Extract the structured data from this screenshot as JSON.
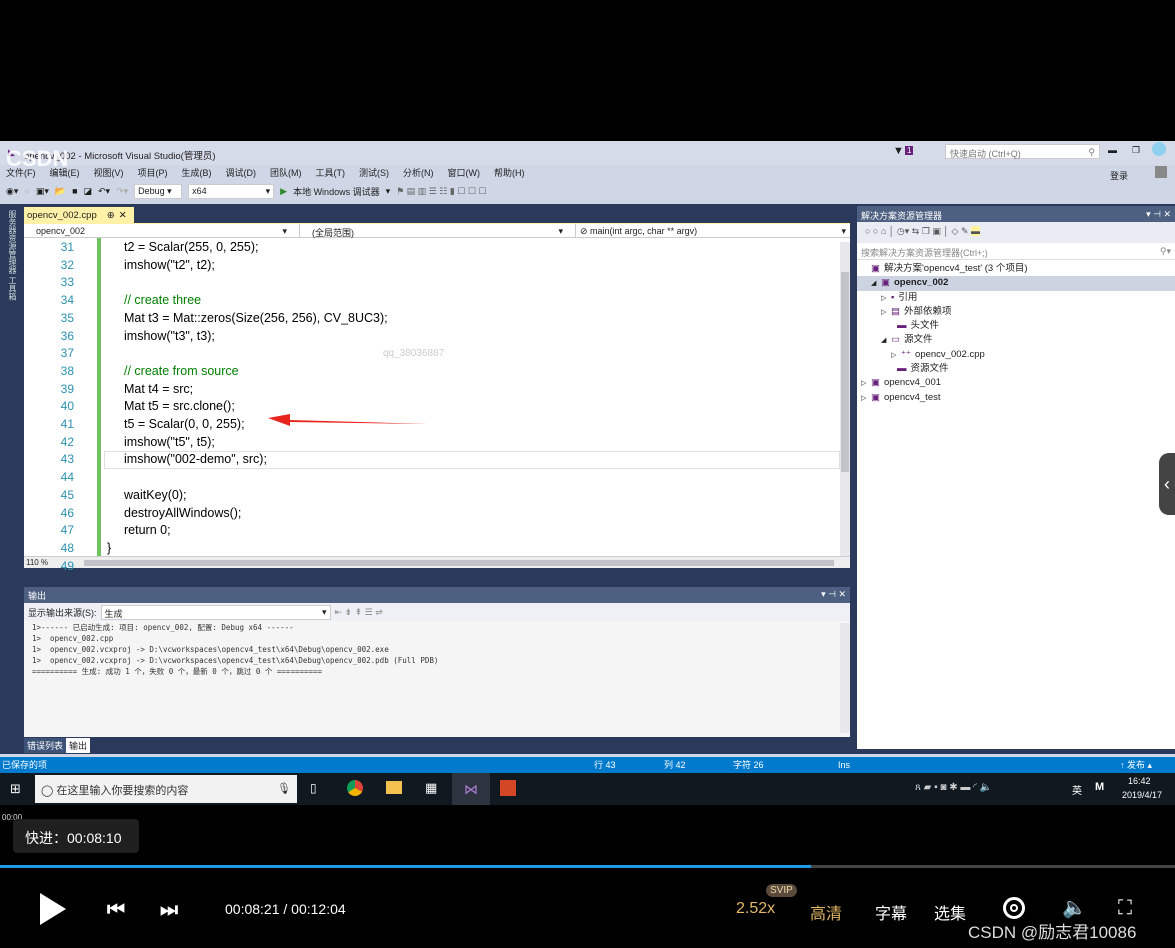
{
  "window": {
    "title": "opencv_002 - Microsoft Visual Studio(管理员)",
    "quick_launch_placeholder": "快速启动 (Ctrl+Q)",
    "notification_count": "1",
    "login": "登录"
  },
  "menu": [
    "文件(F)",
    "编辑(E)",
    "视图(V)",
    "项目(P)",
    "生成(B)",
    "调试(D)",
    "团队(M)",
    "工具(T)",
    "测试(S)",
    "分析(N)",
    "窗口(W)",
    "帮助(H)"
  ],
  "toolbar": {
    "config": "Debug",
    "platform": "x64",
    "run_label": "本地 Windows 调试器"
  },
  "editor": {
    "tab": "opencv_002.cpp",
    "project_dropdown": "opencv_002",
    "scope_dropdown": "(全局范围)",
    "member_dropdown": "main(int argc, char ** argv)",
    "zoom": "110 %",
    "watermark": "qq_38036887",
    "lines": [
      {
        "n": "31",
        "text": "t2 = Scalar(255, 0, 255);"
      },
      {
        "n": "32",
        "text": "imshow(\"t2\", t2);"
      },
      {
        "n": "33",
        "text": ""
      },
      {
        "n": "34",
        "text": "// create three"
      },
      {
        "n": "35",
        "text": "Mat t3 = Mat::zeros(Size(256, 256), CV_8UC3);"
      },
      {
        "n": "36",
        "text": "imshow(\"t3\", t3);"
      },
      {
        "n": "37",
        "text": ""
      },
      {
        "n": "38",
        "text": "// create from source"
      },
      {
        "n": "39",
        "text": "Mat t4 = src;"
      },
      {
        "n": "40",
        "text": "Mat t5 = src.clone();"
      },
      {
        "n": "41",
        "text": "t5 = Scalar(0, 0, 255);"
      },
      {
        "n": "42",
        "text": "imshow(\"t5\", t5);"
      },
      {
        "n": "43",
        "text": "imshow(\"002-demo\", src);"
      },
      {
        "n": "44",
        "text": ""
      },
      {
        "n": "45",
        "text": "waitKey(0);"
      },
      {
        "n": "46",
        "text": "destroyAllWindows();"
      },
      {
        "n": "47",
        "text": "return 0;"
      },
      {
        "n": "48",
        "text": "}"
      },
      {
        "n": "49",
        "text": ""
      }
    ]
  },
  "output": {
    "title": "输出",
    "source_label": "显示输出来源(S):",
    "source_value": "生成",
    "lines": [
      "1>------ 已启动生成: 项目: opencv_002, 配置: Debug x64 ------",
      "1>  opencv_002.cpp",
      "1>  opencv_002.vcxproj -> D:\\vcworkspaces\\opencv4_test\\x64\\Debug\\opencv_002.exe",
      "1>  opencv_002.vcxproj -> D:\\vcworkspaces\\opencv4_test\\x64\\Debug\\opencv_002.pdb (Full PDB)",
      "========== 生成: 成功 1 个，失败 0 个，最新 0 个，跳过 0 个 =========="
    ],
    "tabs": [
      "错误列表",
      "输出"
    ]
  },
  "solution": {
    "title": "解决方案资源管理器",
    "search_placeholder": "搜索解决方案资源管理器(Ctrl+;)",
    "items": [
      "解决方案'opencv4_test' (3 个项目)",
      "opencv_002",
      "引用",
      "外部依赖项",
      "头文件",
      "源文件",
      "opencv_002.cpp",
      "资源文件",
      "opencv4_001",
      "opencv4_test"
    ]
  },
  "status": {
    "message": "已保存的项",
    "row": "行 43",
    "col": "列 42",
    "char": "字符 26",
    "mode": "Ins",
    "publish": "↑ 发布 ▴"
  },
  "taskbar": {
    "search_placeholder": "在这里输入你要搜索的内容",
    "ime": "英",
    "time": "16:42",
    "date": "2019/4/17"
  },
  "player": {
    "hover_time": "00:00",
    "seek_tooltip": "快进：00:08:10",
    "current": "00:08:21",
    "duration": "00:12:04",
    "time_text": "00:08:21 / 00:12:04",
    "progress": 0.69,
    "speed": "2.52x",
    "svip": "SVIP",
    "quality": "高清",
    "subtitle": "字幕",
    "episodes": "选集",
    "watermark": "CSDN @励志君10086",
    "accent": "#1e9be8"
  }
}
